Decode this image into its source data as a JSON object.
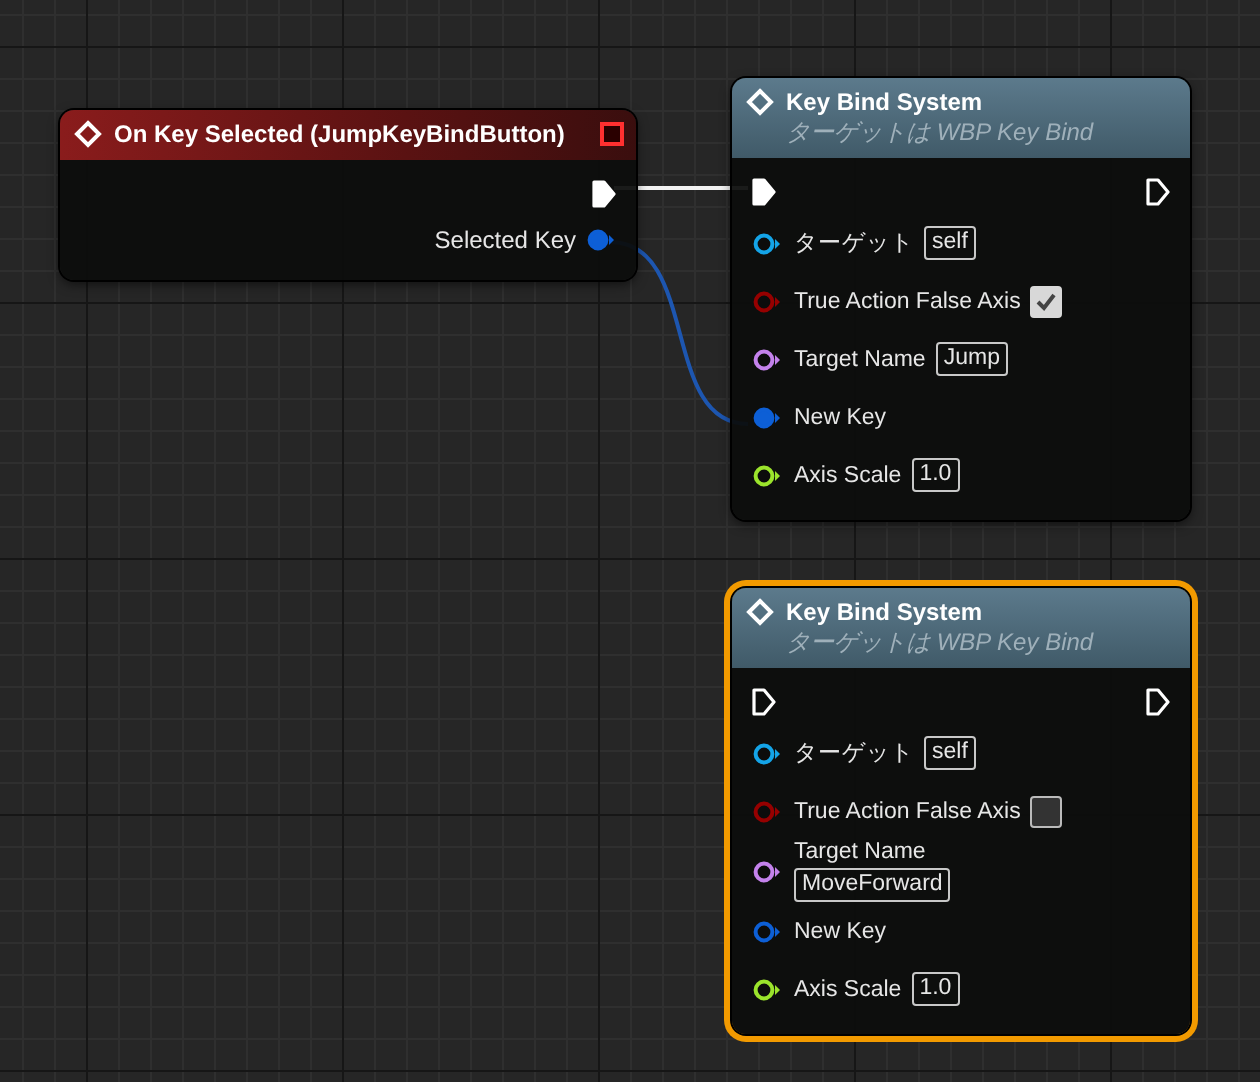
{
  "nodes": [
    {
      "kind": "event",
      "title": "On Key Selected (JumpKeyBindButton)",
      "selected": false,
      "exec_out": {
        "connected": true
      },
      "outputs": [
        {
          "label": "Selected Key",
          "color": "#0d5fd6",
          "connected": true
        }
      ]
    },
    {
      "kind": "function",
      "title": "Key Bind System",
      "subtitle": "ターゲットは WBP Key Bind",
      "selected": false,
      "exec_in": {
        "connected": true
      },
      "exec_out": {
        "connected": false
      },
      "inputs": [
        {
          "label": "ターゲット",
          "color": "#14a4e8",
          "connected": false,
          "value": "self"
        },
        {
          "label": "True Action False Axis",
          "color": "#960000",
          "connected": false,
          "checked": true
        },
        {
          "label": "Target Name",
          "color": "#c482ec",
          "connected": false,
          "value": "Jump"
        },
        {
          "label": "New Key",
          "color": "#0d5fd6",
          "connected": true
        },
        {
          "label": "Axis Scale",
          "color": "#9be42c",
          "connected": false,
          "value": "1.0"
        }
      ]
    },
    {
      "kind": "function",
      "title": "Key Bind System",
      "subtitle": "ターゲットは WBP Key Bind",
      "selected": true,
      "exec_in": {
        "connected": false
      },
      "exec_out": {
        "connected": false
      },
      "inputs": [
        {
          "label": "ターゲット",
          "color": "#14a4e8",
          "connected": false,
          "value": "self"
        },
        {
          "label": "True Action False Axis",
          "color": "#960000",
          "connected": false,
          "checked": false
        },
        {
          "label": "Target Name",
          "color": "#c482ec",
          "connected": false,
          "value": "MoveForward"
        },
        {
          "label": "New Key",
          "color": "#0d5fd6",
          "connected": false
        },
        {
          "label": "Axis Scale",
          "color": "#9be42c",
          "connected": false,
          "value": "1.0"
        }
      ]
    }
  ]
}
